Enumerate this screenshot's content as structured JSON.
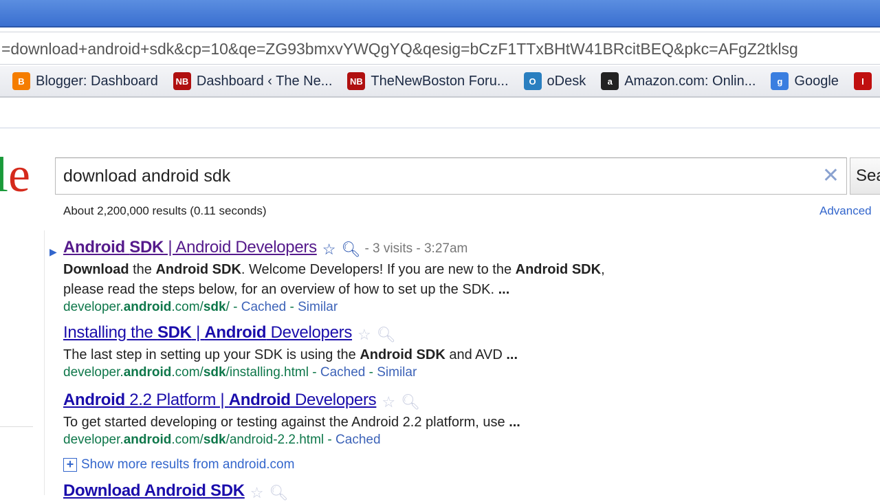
{
  "browser": {
    "address": "=download+android+sdk&cp=10&qe=ZG93bmxvYWQgYQ&qesig=bCzF1TTxBHtW41BRcitBEQ&pkc=AFgZ2tklsg",
    "bookmarks": [
      {
        "label": "Blogger: Dashboard",
        "icon": "blogger-icon",
        "icon_text": "B",
        "color": "#f57d00"
      },
      {
        "label": "Dashboard ‹ The Ne...",
        "icon": "newboston-icon",
        "icon_text": "NB",
        "color": "#b01010"
      },
      {
        "label": "TheNewBoston Foru...",
        "icon": "newboston-icon",
        "icon_text": "NB",
        "color": "#b01010"
      },
      {
        "label": "oDesk",
        "icon": "odesk-icon",
        "icon_text": "O",
        "color": "#2a7fc0"
      },
      {
        "label": "Amazon.com: Onlin...",
        "icon": "amazon-icon",
        "icon_text": "a",
        "color": "#222222"
      },
      {
        "label": "Google",
        "icon": "google-icon",
        "icon_text": "g",
        "color": "#3a7ee0"
      },
      {
        "label": "",
        "icon": "ie-icon",
        "icon_text": "I",
        "color": "#c01010"
      }
    ]
  },
  "search": {
    "logo_partial": "le",
    "query": "download android sdk",
    "button": "Sea",
    "stats": "About 2,200,000 results (0.11 seconds)",
    "advanced": "Advanced"
  },
  "results": [
    {
      "title": [
        [
          "Android ",
          1
        ],
        [
          "SDK",
          1
        ],
        [
          " | Android Developers",
          0
        ]
      ],
      "visited": true,
      "meta": "- 3 visits - 3:27am",
      "snippet": [
        [
          [
            "Download",
            1
          ],
          [
            " the ",
            0
          ],
          [
            "Android SDK",
            1
          ],
          [
            ". Welcome Developers! If you are new to the ",
            0
          ],
          [
            "Android SDK",
            1
          ],
          [
            ",",
            0
          ]
        ],
        [
          [
            "please read the steps below, for an overview of how to set up the SDK. ",
            0
          ],
          [
            "...",
            1
          ]
        ]
      ],
      "url": [
        [
          "developer.",
          0
        ],
        [
          "android",
          1
        ],
        [
          ".com/",
          0
        ],
        [
          "sdk",
          1
        ],
        [
          "/",
          0
        ]
      ],
      "links": [
        "Cached",
        "Similar"
      ]
    },
    {
      "title": [
        [
          "Installing the ",
          0
        ],
        [
          "SDK",
          1
        ],
        [
          " | ",
          0
        ],
        [
          "Android",
          1
        ],
        [
          " Developers",
          0
        ]
      ],
      "visited": false,
      "meta": "",
      "snippet": [
        [
          [
            "The last step in setting up your SDK is using the ",
            0
          ],
          [
            "Android SDK",
            1
          ],
          [
            " and AVD ",
            0
          ],
          [
            "...",
            1
          ]
        ]
      ],
      "url": [
        [
          "developer.",
          0
        ],
        [
          "android",
          1
        ],
        [
          ".com/",
          0
        ],
        [
          "sdk",
          1
        ],
        [
          "/installing.html",
          0
        ]
      ],
      "links": [
        "Cached",
        "Similar"
      ]
    },
    {
      "title": [
        [
          "Android",
          1
        ],
        [
          " 2.2 Platform | ",
          0
        ],
        [
          "Android",
          1
        ],
        [
          " Developers",
          0
        ]
      ],
      "visited": false,
      "meta": "",
      "snippet": [
        [
          [
            "To get started developing or testing against the Android 2.2 platform, use ",
            0
          ],
          [
            "...",
            1
          ]
        ]
      ],
      "url": [
        [
          "developer.",
          0
        ],
        [
          "android",
          1
        ],
        [
          ".com/",
          0
        ],
        [
          "sdk",
          1
        ],
        [
          "/android-2.2.html",
          0
        ]
      ],
      "links": [
        "Cached"
      ]
    },
    {
      "title": [
        [
          "Download Android SDK",
          1
        ]
      ],
      "visited": false,
      "meta": "",
      "snippet": [],
      "url": [],
      "links": []
    }
  ],
  "more_results": "Show more results from android.com"
}
